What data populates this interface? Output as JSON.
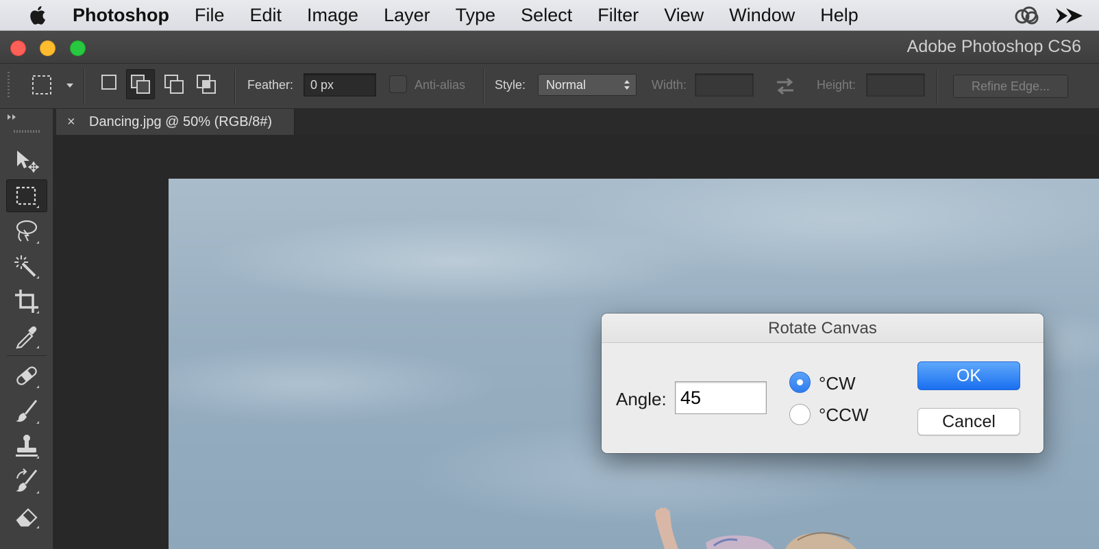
{
  "menubar": {
    "app_name": "Photoshop",
    "menus": [
      "File",
      "Edit",
      "Image",
      "Layer",
      "Type",
      "Select",
      "Filter",
      "View",
      "Window",
      "Help"
    ]
  },
  "window": {
    "title": "Adobe Photoshop CS6"
  },
  "options_bar": {
    "feather_label": "Feather:",
    "feather_value": "0 px",
    "antialias_label": "Anti-alias",
    "style_label": "Style:",
    "style_value": "Normal",
    "width_label": "Width:",
    "height_label": "Height:",
    "refine_edge_label": "Refine Edge..."
  },
  "document": {
    "tab_close": "×",
    "tab_title": "Dancing.jpg @ 50% (RGB/8#)"
  },
  "dialog": {
    "title": "Rotate Canvas",
    "angle_label": "Angle:",
    "angle_value": "45",
    "cw_label": "°CW",
    "ccw_label": "°CCW",
    "selected_direction": "CW",
    "ok_label": "OK",
    "cancel_label": "Cancel"
  },
  "tools": [
    "move-tool-icon",
    "rectangular-marquee-tool-icon",
    "lasso-tool-icon",
    "magic-wand-tool-icon",
    "crop-tool-icon",
    "eyedropper-tool-icon",
    "healing-brush-tool-icon",
    "brush-tool-icon",
    "clone-stamp-tool-icon",
    "history-brush-tool-icon",
    "eraser-tool-icon"
  ],
  "colors": {
    "accent_blue": "#2f7cf0",
    "close": "#fe5f57",
    "minimize": "#febc2e",
    "zoom": "#28c840"
  }
}
